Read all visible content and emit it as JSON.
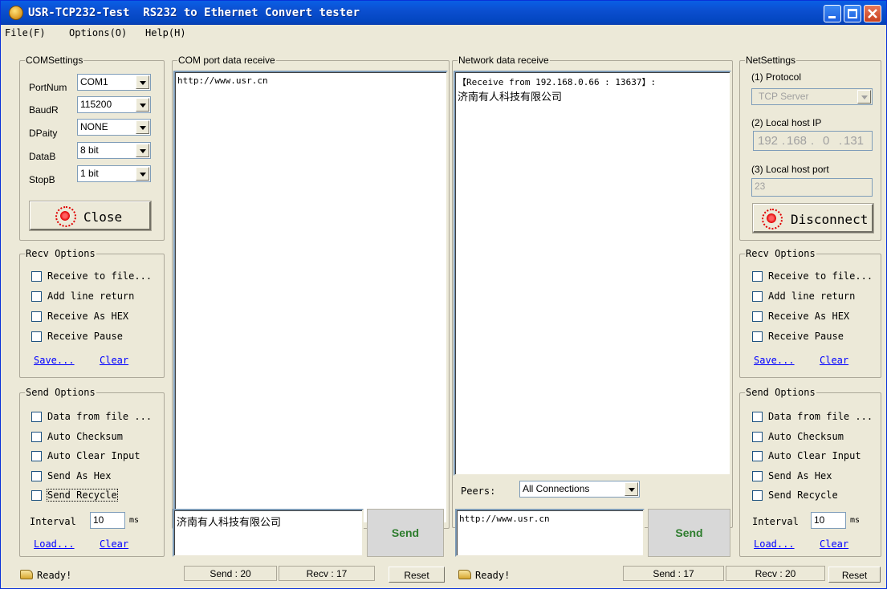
{
  "window": {
    "app_name": "USR-TCP232-Test",
    "subtitle": "RS232 to Ethernet Convert tester"
  },
  "menu": {
    "file": "File(F)",
    "options": "Options(O)",
    "help": "Help(H)"
  },
  "com_settings": {
    "legend": "COMSettings",
    "portnum_label": "PortNum",
    "portnum_value": "COM1",
    "baud_label": "BaudR",
    "baud_value": "115200",
    "parity_label": "DPaity",
    "parity_value": "NONE",
    "databits_label": "DataB",
    "databits_value": "8 bit",
    "stopbits_label": "StopB",
    "stopbits_value": "1 bit",
    "close_button": "Close"
  },
  "left_recv": {
    "legend": "Recv Options",
    "opt1": "Receive to file...",
    "opt2": "Add line return",
    "opt3": "Receive As HEX",
    "opt4": "Receive Pause",
    "save": "Save...",
    "clear": "Clear"
  },
  "left_send": {
    "legend": "Send Options",
    "opt1": "Data from file ...",
    "opt2": "Auto Checksum",
    "opt3": "Auto Clear Input",
    "opt4": "Send As Hex",
    "opt5": "Send Recycle",
    "interval_label": "Interval",
    "interval_value": "10",
    "interval_unit": "ms",
    "load": "Load...",
    "clear": "Clear"
  },
  "com_receive": {
    "legend": "COM port data receive",
    "content": "http://www.usr.cn"
  },
  "com_send": {
    "input": "济南有人科技有限公司",
    "send": "Send"
  },
  "net_receive": {
    "legend": "Network data receive",
    "line1": "【Receive from 192.168.0.66 : 13637】:",
    "line2": "济南有人科技有限公司"
  },
  "peers": {
    "label": "Peers:",
    "value": "All Connections"
  },
  "net_send": {
    "input": "http://www.usr.cn",
    "send": "Send"
  },
  "net_settings": {
    "legend": "NetSettings",
    "protocol_label": "(1) Protocol",
    "protocol_value": "TCP Server",
    "ip_label": "(2) Local host IP",
    "ip1": "192",
    "ip2": "168",
    "ip3": "0",
    "ip4": "131",
    "port_label": "(3) Local host port",
    "port_value": "23",
    "disconnect_button": "Disconnect"
  },
  "right_recv": {
    "legend": "Recv Options",
    "opt1": "Receive to file...",
    "opt2": "Add line return",
    "opt3": "Receive As HEX",
    "opt4": "Receive Pause",
    "save": "Save...",
    "clear": "Clear"
  },
  "right_send": {
    "legend": "Send Options",
    "opt1": "Data from file ...",
    "opt2": "Auto Checksum",
    "opt3": "Auto Clear Input",
    "opt4": "Send As Hex",
    "opt5": "Send Recycle",
    "interval_label": "Interval",
    "interval_value": "10",
    "interval_unit": "ms",
    "load": "Load...",
    "clear": "Clear"
  },
  "status_left": {
    "ready": "Ready!",
    "send": "Send : 20",
    "recv": "Recv : 17",
    "reset": "Reset"
  },
  "status_right": {
    "ready": "Ready!",
    "send": "Send : 17",
    "recv": "Recv : 20",
    "reset": "Reset"
  }
}
